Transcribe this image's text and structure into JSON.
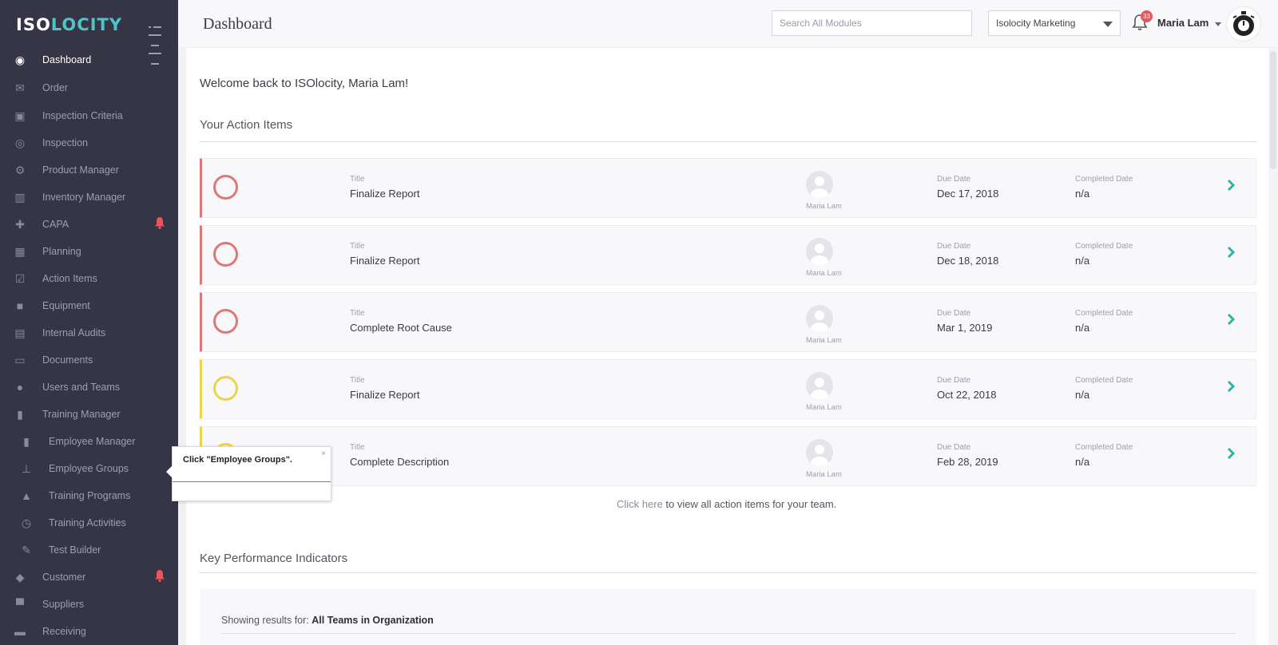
{
  "app": {
    "logo_text_a": "ISO",
    "logo_text_b": "LOCITY"
  },
  "sidebar": {
    "items": [
      {
        "label": "Dashboard",
        "icon": "dashboard-icon",
        "glyph": "◉",
        "active": true
      },
      {
        "label": "Order",
        "icon": "inbox-icon",
        "glyph": "✉"
      },
      {
        "label": "Inspection Criteria",
        "icon": "image-icon",
        "glyph": "▣"
      },
      {
        "label": "Inspection",
        "icon": "target-icon",
        "glyph": "◎"
      },
      {
        "label": "Product Manager",
        "icon": "gear-icon",
        "glyph": "⚙"
      },
      {
        "label": "Inventory Manager",
        "icon": "barcode-icon",
        "glyph": "▥"
      },
      {
        "label": "CAPA",
        "icon": "medkit-icon",
        "glyph": "✚",
        "alert": true
      },
      {
        "label": "Planning",
        "icon": "map-icon",
        "glyph": "▦"
      },
      {
        "label": "Action Items",
        "icon": "checkbox-icon",
        "glyph": "☑"
      },
      {
        "label": "Equipment",
        "icon": "truck-icon",
        "glyph": "■"
      },
      {
        "label": "Internal Audits",
        "icon": "document-icon",
        "glyph": "▤"
      },
      {
        "label": "Documents",
        "icon": "folder-icon",
        "glyph": "▭"
      },
      {
        "label": "Users and Teams",
        "icon": "users-icon",
        "glyph": "●"
      },
      {
        "label": "Training Manager",
        "icon": "book-icon",
        "glyph": "▮"
      },
      {
        "label": "Employee Manager",
        "icon": "id-badge-icon",
        "glyph": "▮",
        "sub": true
      },
      {
        "label": "Employee Groups",
        "icon": "sitemap-icon",
        "glyph": "⊥",
        "sub": true
      },
      {
        "label": "Training Programs",
        "icon": "graduation-cap-icon",
        "glyph": "▲",
        "sub": true
      },
      {
        "label": "Training Activities",
        "icon": "clock-icon",
        "glyph": "◷",
        "sub": true
      },
      {
        "label": "Test Builder",
        "icon": "pencil-icon",
        "glyph": "✎",
        "sub": true
      },
      {
        "label": "Customer",
        "icon": "tag-icon",
        "glyph": "◆",
        "alert": true
      },
      {
        "label": "Suppliers",
        "icon": "supplier-icon",
        "glyph": "▀"
      },
      {
        "label": "Receiving",
        "icon": "receiving-icon",
        "glyph": "▬"
      }
    ]
  },
  "header": {
    "title": "Dashboard",
    "search_placeholder": "Search All Modules",
    "org_selected": "Isolocity Marketing",
    "notif_count": "33",
    "user_name": "Maria Lam"
  },
  "main": {
    "welcome": "Welcome back to ISOlocity, Maria Lam!",
    "action_section_title": "Your Action Items",
    "labels": {
      "title": "Title",
      "due": "Due Date",
      "completed": "Completed Date"
    },
    "action_items": [
      {
        "title": "Finalize Report",
        "assignee": "Maria Lam",
        "due": "Dec 17, 2018",
        "completed": "n/a",
        "status_color": "#e07676"
      },
      {
        "title": "Finalize Report",
        "assignee": "Maria Lam",
        "due": "Dec 18, 2018",
        "completed": "n/a",
        "status_color": "#e07676"
      },
      {
        "title": "Complete Root Cause",
        "assignee": "Maria Lam",
        "due": "Mar 1, 2019",
        "completed": "n/a",
        "status_color": "#e07676"
      },
      {
        "title": "Finalize Report",
        "assignee": "Maria Lam",
        "due": "Oct 22, 2018",
        "completed": "n/a",
        "status_color": "#ecd34a"
      },
      {
        "title": "Complete Description",
        "assignee": "Maria Lam",
        "due": "Feb 28, 2019",
        "completed": "n/a",
        "status_color": "#ecd34a"
      }
    ],
    "view_all_link": "Click here",
    "view_all_rest": " to view all action items for your team.",
    "kpi_title": "Key Performance Indicators",
    "kpi_showing": "Showing results for: ",
    "kpi_scope": "All Teams in Organization"
  },
  "tooltip": {
    "message": "Click \"Employee Groups\".",
    "close": "×"
  },
  "colors": {
    "sidebar_bg": "#363545",
    "accent_teal": "#2fb3a5",
    "alert_red": "#e8555a"
  }
}
